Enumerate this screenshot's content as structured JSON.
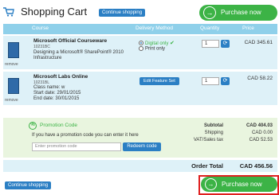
{
  "header": {
    "title": "Shopping Cart",
    "continue_label": "Continue shopping",
    "purchase_label": "Purchase now"
  },
  "columns": [
    "Course",
    "Delivery Method",
    "Quantity",
    "Price"
  ],
  "items": [
    {
      "name": "Microsoft Official Courseware",
      "code": "10231BC",
      "desc1": "Designing a Microsoft® SharePoint® 2010",
      "desc2": "Infrastructure",
      "remove": "remove",
      "delivery_options": [
        "Digital only",
        "Print only"
      ],
      "selected_delivery": "Digital only",
      "quantity": "1",
      "price": "CAD 345.61"
    },
    {
      "name": "Microsoft Labs Online",
      "code": "10231BL",
      "class_name": "Class name: w",
      "start_date": "Start date: 29/01/2015",
      "end_date": "End date: 30/01/2015",
      "remove": "remove",
      "edit_label": "Edit Feature Set",
      "quantity": "1",
      "price": "CAD 58.22"
    }
  ],
  "promo": {
    "title": "Promotion Code",
    "description": "If you have a promotion code you can enter it here",
    "placeholder": "Enter promotion code",
    "redeem_label": "Redeem code"
  },
  "summary": {
    "subtotal_label": "Subtotal",
    "subtotal_value": "CAD 404.03",
    "shipping_label": "Shipping",
    "shipping_value": "CAD 0.00",
    "vat_label": "VAT/Sales tax",
    "vat_value": "CAD 52.53",
    "total_label": "Order Total",
    "total_value": "CAD 456.56"
  },
  "footer": {
    "continue_label": "Continue shopping",
    "purchase_label": "Purchase now"
  },
  "colors": {
    "accent_blue": "#2b7fc4",
    "header_blue": "#8fd0ea",
    "row_bg": "#def1f8",
    "green": "#3cb346",
    "promo_bg": "#e9f5df",
    "highlight_red": "#e02020"
  }
}
